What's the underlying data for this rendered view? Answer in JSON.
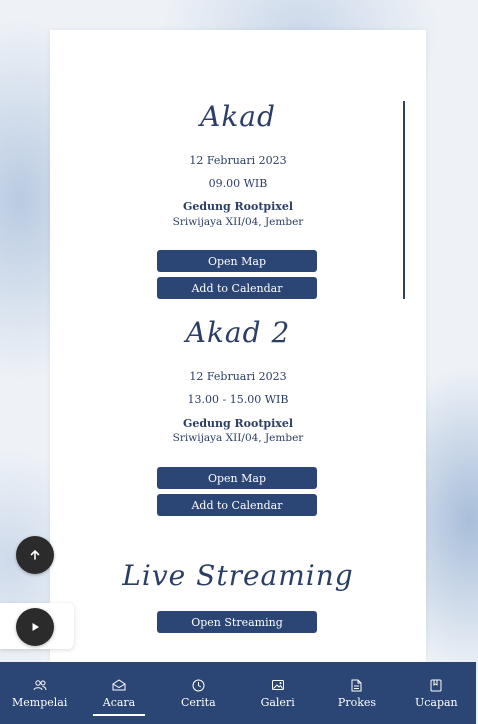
{
  "events": [
    {
      "title": "Akad",
      "date": "12 Februari 2023",
      "time": "09.00 WIB",
      "venue": "Gedung Rootpixel",
      "address": "Sriwijaya XII/04, Jember",
      "map_label": "Open Map",
      "calendar_label": "Add to Calendar"
    },
    {
      "title": "Akad 2",
      "date": "12 Februari 2023",
      "time": "13.00 - 15.00 WIB",
      "venue": "Gedung Rootpixel",
      "address": "Sriwijaya XII/04, Jember",
      "map_label": "Open Map",
      "calendar_label": "Add to Calendar"
    }
  ],
  "streaming": {
    "title": "Live Streaming",
    "button_label": "Open Streaming"
  },
  "nav": {
    "items": [
      {
        "label": "Mempelai",
        "icon": "people-icon"
      },
      {
        "label": "Acara",
        "icon": "envelope-icon"
      },
      {
        "label": "Cerita",
        "icon": "clock-icon"
      },
      {
        "label": "Galeri",
        "icon": "gallery-icon"
      },
      {
        "label": "Prokes",
        "icon": "document-icon"
      },
      {
        "label": "Ucapan",
        "icon": "book-icon"
      }
    ],
    "active": "Acara"
  },
  "colors": {
    "primary": "#2b4575",
    "text": "#2b3e66"
  }
}
